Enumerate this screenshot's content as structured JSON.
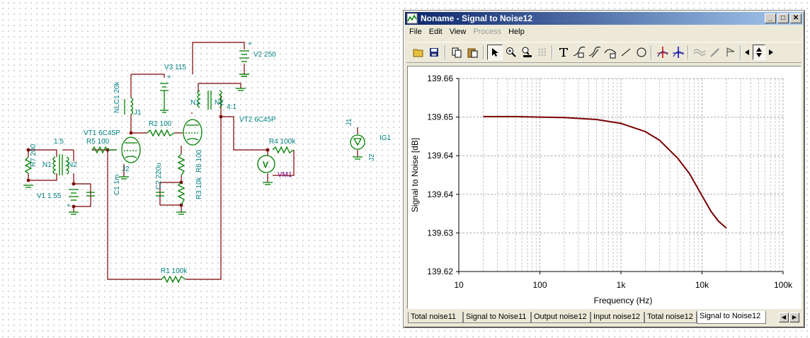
{
  "schematic": {
    "labels": {
      "v2": "V2 250",
      "v3": "V3 115",
      "nlc1": "NLC1 20k",
      "j1a": "J1",
      "n1": "N1",
      "n2": "N2",
      "ratio41": "4:1",
      "vt2": "VT2 6C45P",
      "r2": "R2 100",
      "vt1": "VT1 6C45P",
      "r5": "R5 100",
      "ratio15": "1:5",
      "r7": "R7 200",
      "tn1": "N1",
      "tn2": "N2",
      "j2a": "J2",
      "r6": "R6 100",
      "c2": "C2 220u",
      "r3": "R3 10k",
      "v1": "V1 1.55",
      "c1": "C1 1m",
      "r4": "R4 100k",
      "vm1": "VM1",
      "r1": "R1 100k",
      "j1b": "J1",
      "j2b": "J2",
      "ig1": "IG1",
      "meter_symbol": "V",
      "plus": "+"
    }
  },
  "window": {
    "title": "Noname - Signal to Noise12",
    "buttons": {
      "minimize": "_",
      "maximize": "□",
      "close": "✕"
    },
    "menu": [
      {
        "label": "File",
        "enabled": true
      },
      {
        "label": "Edit",
        "enabled": true
      },
      {
        "label": "View",
        "enabled": true
      },
      {
        "label": "Process",
        "enabled": false
      },
      {
        "label": "Help",
        "enabled": true
      }
    ],
    "toolbar_icons": [
      "open-icon",
      "save-icon",
      "copy-icon",
      "paste-icon",
      "pointer-icon",
      "zoom-in-icon",
      "zoom-100-icon",
      "grid-icon",
      "text-icon",
      "curve-label-icon",
      "curve-tag-icon",
      "curve-edit-icon",
      "line-icon",
      "circle-icon",
      "cursor-a-icon",
      "cursor-b-icon",
      "wave-icon",
      "pen-icon",
      "flag-icon",
      "scroll-left-icon",
      "scroll-updown-icon",
      "scroll-right-icon"
    ],
    "tabs": [
      {
        "label": "Total noise11",
        "active": false
      },
      {
        "label": "Signal to Noise11",
        "active": false
      },
      {
        "label": "Output noise12",
        "active": false
      },
      {
        "label": "Input noise12",
        "active": false
      },
      {
        "label": "Total noise12",
        "active": false
      },
      {
        "label": "Signal to Noise12",
        "active": true
      }
    ],
    "tab_nav": {
      "left": "◀",
      "right": "▶"
    }
  },
  "chart_data": {
    "type": "line",
    "xlabel": "Frequency (Hz)",
    "ylabel": "Signal to Noise [dB]",
    "x_scale": "log",
    "xlim": [
      10,
      100000
    ],
    "ylim": [
      139.62,
      139.66
    ],
    "x_ticks": [
      10,
      100,
      1000,
      10000,
      100000
    ],
    "x_tick_labels": [
      "10",
      "100",
      "1k",
      "10k",
      "100k"
    ],
    "y_ticks": [
      139.66,
      139.65,
      139.64,
      139.63,
      139.62
    ],
    "y_tick_labels": [
      "139.66",
      "139.65",
      "139.64",
      "139.64",
      "139.63",
      "139.62"
    ],
    "grid": true,
    "series": [
      {
        "color": "#7a0000",
        "x": [
          20,
          50,
          100,
          200,
          500,
          1000,
          2000,
          3000,
          5000,
          7000,
          10000,
          13000,
          16000,
          20000
        ],
        "y": [
          139.6521,
          139.6521,
          139.652,
          139.6519,
          139.6515,
          139.6507,
          139.649,
          139.6472,
          139.6435,
          139.6403,
          139.6357,
          139.6324,
          139.6304,
          139.629
        ]
      }
    ]
  }
}
